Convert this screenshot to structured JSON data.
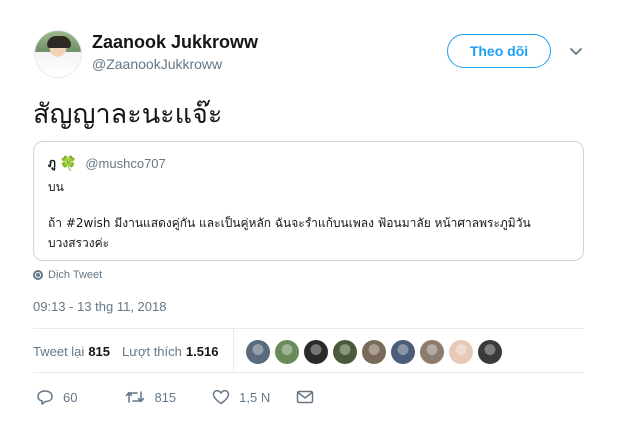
{
  "author": {
    "name": "Zaanook Jukkroww",
    "handle": "@ZaanookJukkroww"
  },
  "follow_button": {
    "label": "Theo dõi"
  },
  "tweet": {
    "text": "สัญญาละนะแจ๊ะ",
    "translate_label": "Dịch Tweet",
    "timestamp": "09:13 - 13 thg 11, 2018"
  },
  "quoted_tweet": {
    "name": "ภู",
    "handle": "@mushco707",
    "lines": [
      "บน",
      "ถ้า #2wish มีงานแสดงคู่กัน และเป็นคู่หลัก ฉันจะรำแก้บนเพลง ฟ้อนมาลัย หน้าศาลพระภูมิวัน",
      "บวงสรวงค่ะ"
    ]
  },
  "stats": {
    "retweets_label": "Tweet lại",
    "retweets_count": "815",
    "likes_label": "Lượt thích",
    "likes_count": "1.516"
  },
  "likers": [
    {
      "color": "#5b6b7c"
    },
    {
      "color": "#6a8a5a"
    },
    {
      "color": "#2b2b2b"
    },
    {
      "color": "#4a5a3a"
    },
    {
      "color": "#7a6a5a"
    },
    {
      "color": "#4b5d7a"
    },
    {
      "color": "#8a7d70"
    },
    {
      "color": "#e6c9b8"
    },
    {
      "color": "#3a3a3a"
    }
  ],
  "actions": {
    "reply_count": "60",
    "retweet_count": "815",
    "like_count": "1,5 N"
  },
  "colors": {
    "accent": "#1da1f2",
    "muted": "#657786",
    "border": "#e6ecf0"
  }
}
